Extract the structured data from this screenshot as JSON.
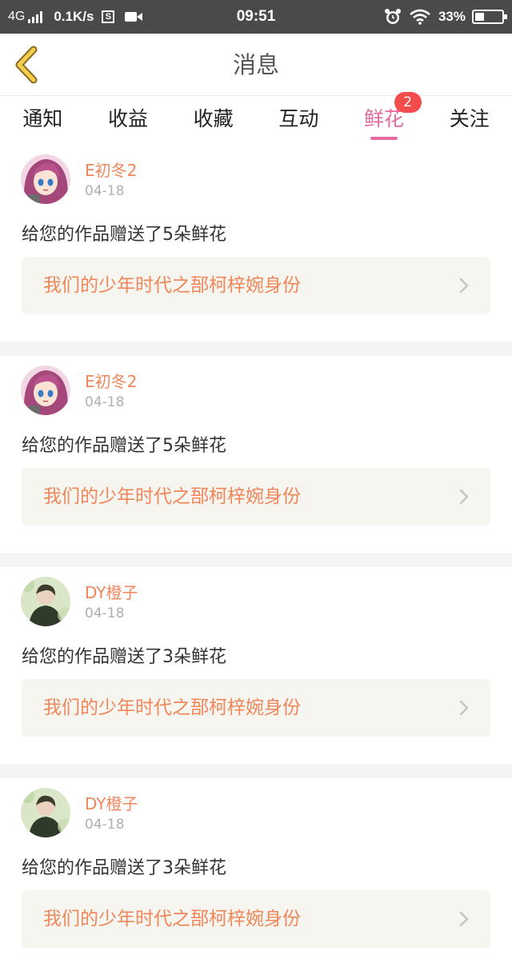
{
  "statusbar": {
    "network": "4G",
    "speed": "0.1K/s",
    "s_icon_text": "S",
    "time": "09:51",
    "battery": "33%",
    "battery_level": 0.33
  },
  "header": {
    "title": "消息"
  },
  "tabs": [
    {
      "label": "通知",
      "active": false
    },
    {
      "label": "收益",
      "active": false
    },
    {
      "label": "收藏",
      "active": false
    },
    {
      "label": "互动",
      "active": false
    },
    {
      "label": "鲜花",
      "active": true,
      "badge": "2"
    },
    {
      "label": "关注",
      "active": false
    }
  ],
  "colors": {
    "accent": "#e36a9e",
    "username": "#f0865a",
    "badge": "#f24c4c"
  },
  "feed": [
    {
      "avatar": "anime-girl-avatar",
      "user": "E初冬2",
      "date": "04-18",
      "message": "给您的作品赠送了5朵鲜花",
      "work": "我们的少年时代之郚柯梓婉身份"
    },
    {
      "avatar": "anime-girl-avatar",
      "user": "E初冬2",
      "date": "04-18",
      "message": "给您的作品赠送了5朵鲜花",
      "work": "我们的少年时代之郚柯梓婉身份"
    },
    {
      "avatar": "boy-portrait-avatar",
      "user": "DY橙子",
      "date": "04-18",
      "message": "给您的作品赠送了3朵鲜花",
      "work": "我们的少年时代之郚柯梓婉身份"
    },
    {
      "avatar": "boy-portrait-avatar",
      "user": "DY橙子",
      "date": "04-18",
      "message": "给您的作品赠送了3朵鲜花",
      "work": "我们的少年时代之郚柯梓婉身份"
    }
  ]
}
